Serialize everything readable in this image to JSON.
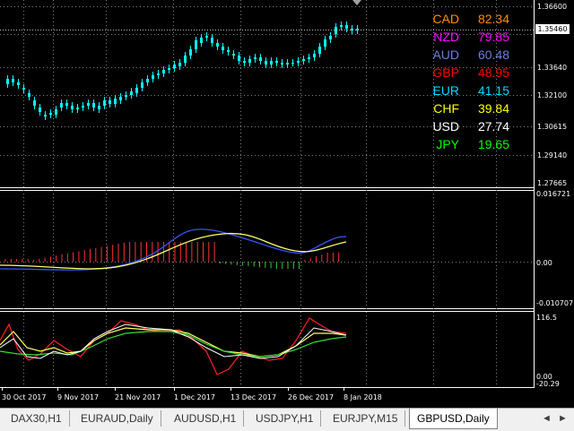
{
  "chart": {
    "symbol": "GBPUSD,Daily",
    "current_price": "1.35460",
    "price_ticks": [
      "1.36600",
      "1.35115",
      "1.33640",
      "1.32100",
      "1.30615",
      "1.29140",
      "1.27665"
    ],
    "osc1_ticks": [
      "0.016721",
      "0.00",
      "-0.010707"
    ],
    "osc2_ticks": [
      "116.5",
      "0.00",
      "-20.29"
    ],
    "date_labels": [
      "30 Oct 2017",
      "9 Nov 2017",
      "21 Nov 2017",
      "1 Dec 2017",
      "13 Dec 2017",
      "26 Dec 2017",
      "8 Jan 2018"
    ],
    "colors": {
      "background": "#000000",
      "candle": "#00ffff",
      "grid": "#808080",
      "histogram_up": "#ff3333",
      "histogram_down": "#33cc33",
      "signal_blue": "#3355ff",
      "signal_yellow": "#ffff66",
      "osc_red": "#ff2222",
      "osc_yellow": "#ffff66",
      "osc_green": "#33dd33",
      "osc_white": "#ffffff"
    }
  },
  "legend": [
    {
      "ccy": "CAD",
      "value": "82.34",
      "color": "#ff8c00"
    },
    {
      "ccy": "NZD",
      "value": "79.85",
      "color": "#ff00ff"
    },
    {
      "ccy": "AUD",
      "value": "60.48",
      "color": "#6a7fdb"
    },
    {
      "ccy": "GBP",
      "value": "48.95",
      "color": "#ff0000"
    },
    {
      "ccy": "EUR",
      "value": "41.15",
      "color": "#00d8ff"
    },
    {
      "ccy": "CHF",
      "value": "39.84",
      "color": "#ffff00"
    },
    {
      "ccy": "USD",
      "value": "27.74",
      "color": "#ffffff"
    },
    {
      "ccy": "JPY",
      "value": "19.65",
      "color": "#00ff00"
    }
  ],
  "tabs": [
    "DAX30,H1",
    "EURAUD,Daily",
    "AUDUSD,H1",
    "USDJPY,H1",
    "EURJPY,M15",
    "GBPUSD,Daily"
  ],
  "active_tab": "GBPUSD,Daily",
  "nav": {
    "left_arrow": "◄",
    "right_arrow": "►"
  }
}
